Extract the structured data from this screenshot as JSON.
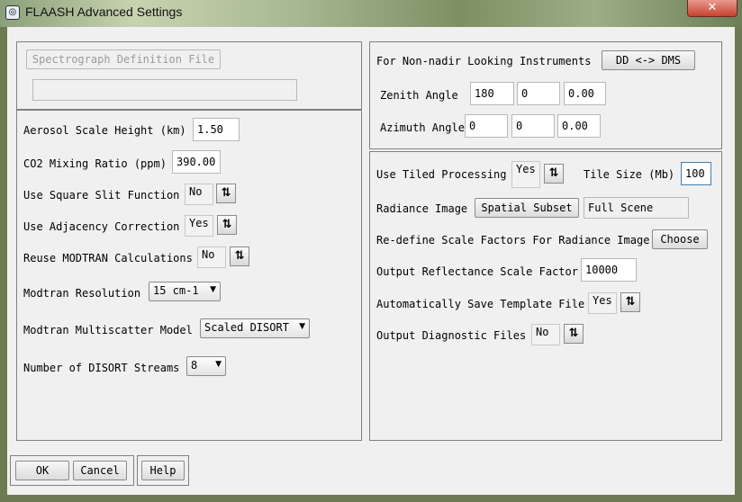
{
  "window": {
    "title": "FLAASH Advanced Settings",
    "close_glyph": "✕",
    "icon": "app-icon"
  },
  "spectro": {
    "button": "Spectrograph Definition File",
    "field_value": ""
  },
  "left": {
    "aerosol_label": "Aerosol Scale Height (km)",
    "aerosol_value": "1.50",
    "co2_label": "CO2 Mixing Ratio (ppm)",
    "co2_value": "390.00",
    "square_slit_label": "Use Square Slit Function",
    "square_slit_value": "No",
    "adjacency_label": "Use Adjacency Correction",
    "adjacency_value": "Yes",
    "reuse_label": "Reuse MODTRAN Calculations",
    "reuse_value": "No",
    "resolution_label": "Modtran Resolution",
    "resolution_value": "15 cm-1",
    "multiscatter_label": "Modtran Multiscatter Model",
    "multiscatter_value": "Scaled DISORT",
    "streams_label": "Number of DISORT Streams",
    "streams_value": "8"
  },
  "nadir": {
    "heading": "For Non-nadir Looking Instruments",
    "dms_button": "DD <-> DMS",
    "zenith_label": "Zenith Angle",
    "zenith": [
      "180",
      "0",
      "0.00"
    ],
    "azimuth_label": "Azimuth Angle",
    "azimuth": [
      "0",
      "0",
      "0.00"
    ]
  },
  "processing": {
    "tiled_label": "Use Tiled Processing",
    "tiled_value": "Yes",
    "tile_size_label": "Tile Size (Mb)",
    "tile_size_value": "100",
    "radiance_label": "Radiance Image",
    "spatial_subset_button": "Spatial Subset",
    "radiance_value": "Full Scene",
    "redefine_label": "Re-define Scale Factors For Radiance Image",
    "choose_button": "Choose",
    "reflectance_label": "Output Reflectance Scale Factor",
    "reflectance_value": "10000",
    "save_template_label": "Automatically Save Template File",
    "save_template_value": "Yes",
    "diagnostic_label": "Output Diagnostic Files",
    "diagnostic_value": "No"
  },
  "footer": {
    "ok": "OK",
    "cancel": "Cancel",
    "help": "Help"
  },
  "toggle_glyph": "⇅",
  "dropdown_glyph": "▼"
}
